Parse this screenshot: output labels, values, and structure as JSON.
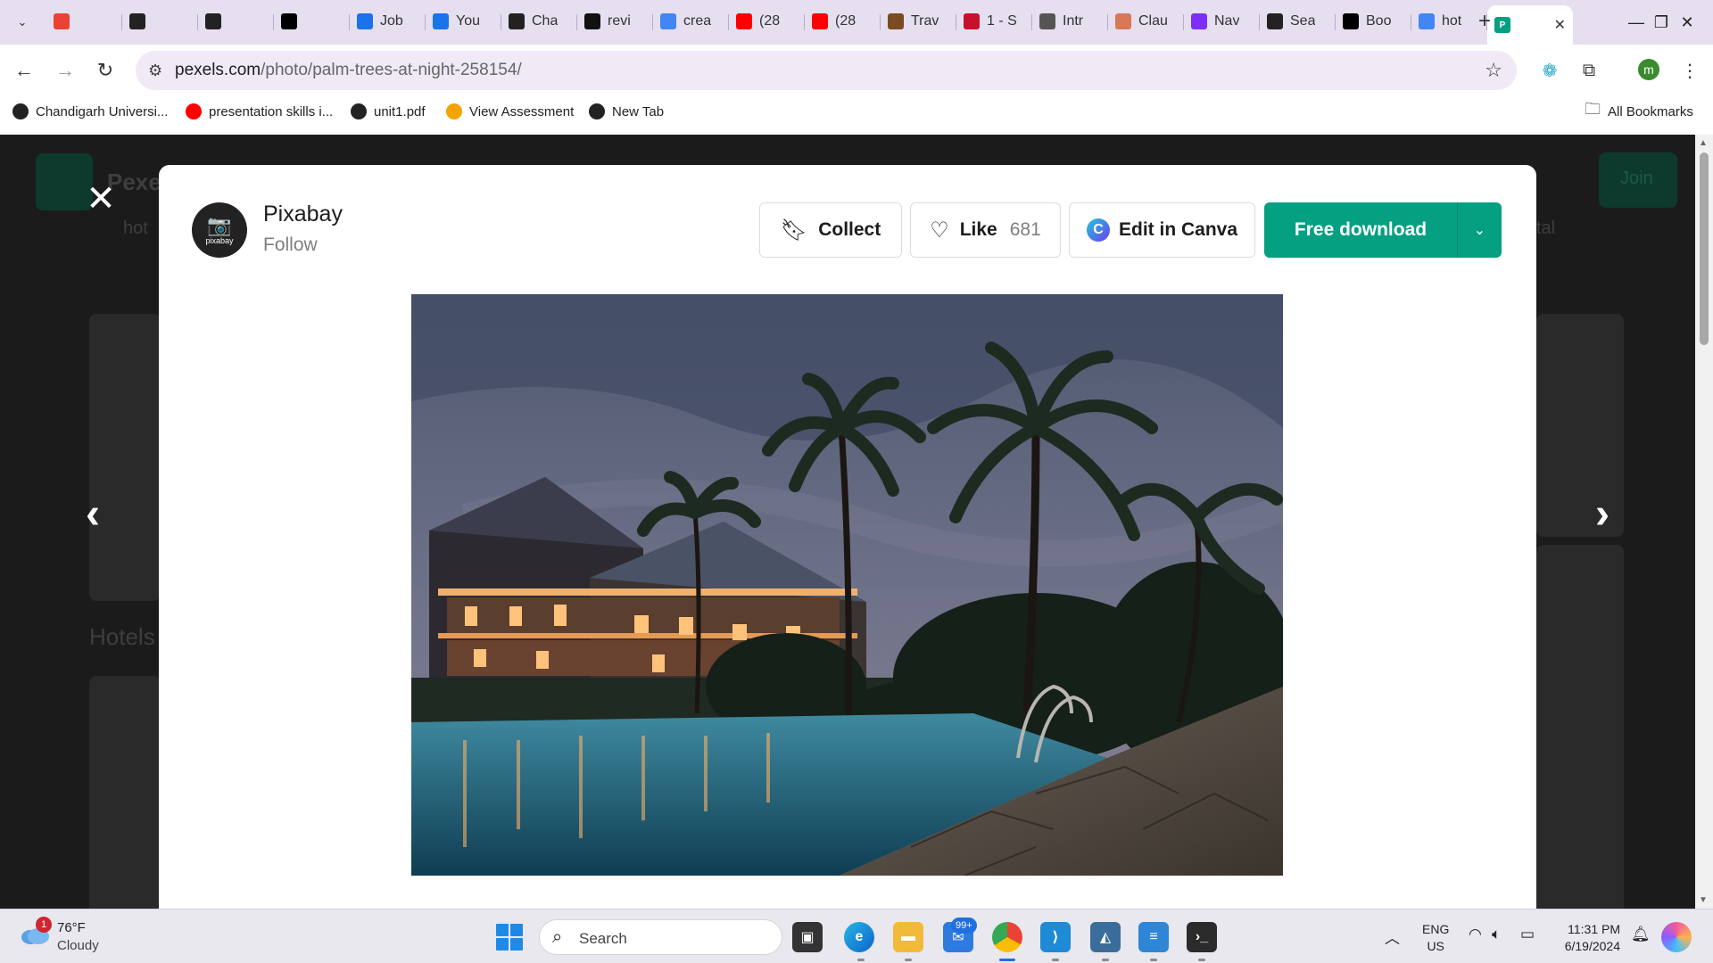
{
  "browser": {
    "tabs": [
      {
        "icon": "gmail-icon",
        "color": "#ea4335",
        "title": ""
      },
      {
        "icon": "play-icon",
        "color": "#222222",
        "title": ""
      },
      {
        "icon": "play-icon",
        "color": "#222222",
        "title": ""
      },
      {
        "icon": "medium-icon",
        "color": "#000000",
        "title": ""
      },
      {
        "icon": "info-icon",
        "color": "#1a73e8",
        "title": "Job"
      },
      {
        "icon": "info-icon",
        "color": "#1a73e8",
        "title": "You"
      },
      {
        "icon": "openai-icon",
        "color": "#222222",
        "title": "Cha"
      },
      {
        "icon": "github-icon",
        "color": "#111111",
        "title": "revi"
      },
      {
        "icon": "google-icon",
        "color": "#4285f4",
        "title": "crea"
      },
      {
        "icon": "youtube-icon",
        "color": "#ff0000",
        "title": "(28"
      },
      {
        "icon": "youtube-icon",
        "color": "#ff0000",
        "title": "(28"
      },
      {
        "icon": "book-icon",
        "color": "#7a4a22",
        "title": "Trav"
      },
      {
        "icon": "red-icon",
        "color": "#c8102e",
        "title": "1 - S"
      },
      {
        "icon": "globe-icon",
        "color": "#555555",
        "title": "Intr"
      },
      {
        "icon": "claude-icon",
        "color": "#d97757",
        "title": "Clau"
      },
      {
        "icon": "b-icon",
        "color": "#7b2ff7",
        "title": "Nav"
      },
      {
        "icon": "perplexity-icon",
        "color": "#222222",
        "title": "Sea"
      },
      {
        "icon": "dev-icon",
        "color": "#000000",
        "title": "Boo"
      },
      {
        "icon": "google-icon",
        "color": "#4285f4",
        "title": "hot"
      }
    ],
    "active_tab": {
      "icon": "pexels-icon",
      "color": "#05a081"
    },
    "url_domain": "pexels.com",
    "url_path": "/photo/palm-trees-at-night-258154/",
    "profile_initial": "m",
    "bookmarks": [
      {
        "label": "Chandigarh Universi...",
        "icon": "globe-icon",
        "color": "#222222"
      },
      {
        "label": "presentation skills i...",
        "icon": "youtube-icon",
        "color": "#ff0000"
      },
      {
        "label": "unit1.pdf",
        "icon": "globe-icon",
        "color": "#222222"
      },
      {
        "label": "View Assessment",
        "icon": "assessment-icon",
        "color": "#f4a300"
      },
      {
        "label": "New Tab",
        "icon": "globe-icon",
        "color": "#222222"
      }
    ],
    "all_bookmarks": "All Bookmarks"
  },
  "background": {
    "logo_text": "Pexe",
    "join_label": "Join",
    "chip_left": "hot",
    "chip_right": "tal",
    "section_label": "Hotels"
  },
  "modal": {
    "author": "Pixabay",
    "avatar_label": "pixabay",
    "follow_label": "Follow",
    "collect_label": "Collect",
    "like_label": "Like",
    "like_count": "681",
    "canva_label": "Edit in Canva",
    "download_label": "Free download",
    "photo_subject": "palm-trees-at-night"
  },
  "taskbar": {
    "weather_badge": "1",
    "weather_temp": "76°F",
    "weather_cond": "Cloudy",
    "search_label": "Search",
    "mail_badge": "99+",
    "lang_line1": "ENG",
    "lang_line2": "US",
    "time": "11:31 PM",
    "date": "6/19/2024"
  },
  "colors": {
    "accent": "#05a081",
    "tabstrip": "#e5dff0"
  }
}
